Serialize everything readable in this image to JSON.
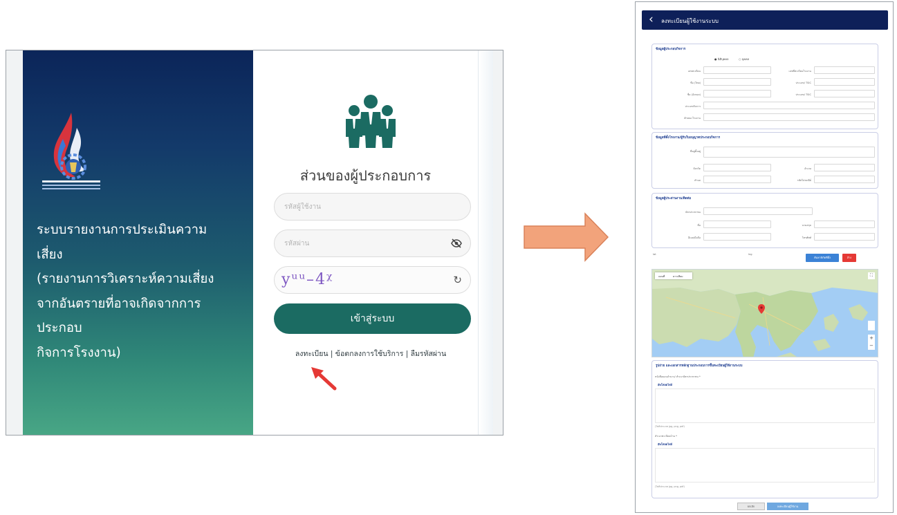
{
  "login": {
    "system_title": "ระบบรายงานการประเมินความ\nเสี่ยง\n(รายงานการวิเคราะห์ความเสี่ยง\nจากอันตรายที่อาจเกิดจากการ\nประกอบ\nกิจการโรงงาน)",
    "portal_title": "ส่วนของผู้ประกอบการ",
    "username_placeholder": "รหัสผู้ใช้งาน",
    "password_placeholder": "รหัสผ่าน",
    "captcha_text": "yᵘᵘ–4ᵡ",
    "refresh_icon": "↻",
    "eye_icon": "eye-slash-icon",
    "login_button": "เข้าสู่ระบบ",
    "links": {
      "register": "ลงทะเบียน",
      "sep1": " | ",
      "terms": "ข้อตกลงการใช้บริการ",
      "sep2": " | ",
      "forgot": "ลืมรหัสผ่าน"
    },
    "colors": {
      "brand_dark": "#0b2559",
      "brand_green": "#1b6b62",
      "arrow_red": "#e53935"
    }
  },
  "flow_arrow": {
    "color": "#f2a37b"
  },
  "form": {
    "header_title": "ลงทะเบียนผู้ใช้งานระบบ",
    "sections": {
      "s1_title": "ข้อมูลผู้ประกอบกิจการ",
      "s2_title": "ข้อมูลที่ตั้งโรงงาน/ผู้รับใบอนุญาตประกอบกิจการ",
      "s3_title": "ข้อมูลผู้ประสานงาน/ติดต่อ",
      "upload_title": "รูปถ่าย และเอกสารหลักฐานประกอบการขึ้นทะเบียนผู้ใช้งานระบบ"
    },
    "radio": {
      "option1": "นิติบุคคล",
      "option2": "บุคคล"
    },
    "labels": {
      "reg_no": "เลขทะเบียน",
      "factory_no": "เลขที่ทะเบียนโรงงาน",
      "name_th": "ชื่อ (ไทย)",
      "tsic": "ประเภท/ TSIC",
      "name_en": "ชื่อ (อังกฤษ)",
      "tsic2": "ประเภท/ TSIC",
      "business_type": "ประเภทกิจการ",
      "factory_type": "ลักษณะโรงงาน",
      "address": "ที่อยู่ตั้งอยู่",
      "province": "จังหวัด",
      "district": "อำเภอ",
      "subdistrict": "ตำบล",
      "zipcode": "รหัสไปรษณีย์",
      "id_card": "บัตรประชาชน",
      "contact_name": "ชื่อ",
      "surname": "นามสกุล",
      "email": "อีเมล/มือถือ",
      "phone": "โทรศัพท์"
    },
    "coords": {
      "lat": "lat",
      "lng": "lng"
    },
    "buttons": {
      "location": "ค้นหาพิกัดที่ตั้ง",
      "clear": "ล้าง",
      "cancel": "ยกเลิก",
      "submit": "ลงทะเบียนผู้ใช้งาน"
    },
    "map": {
      "map_label": "แผนที่",
      "satellite_label": "ดาวเทียม"
    },
    "upload": {
      "label1": "หนังสือมอบอำนาจ/ สำเนาบัตรประชาชน *",
      "label2": "สำเนาทะเบียนบ้าน *",
      "button": "อัพโหลดไฟล์",
      "note": "(ไฟล์ประเภท jpg, png, pdf)"
    }
  }
}
